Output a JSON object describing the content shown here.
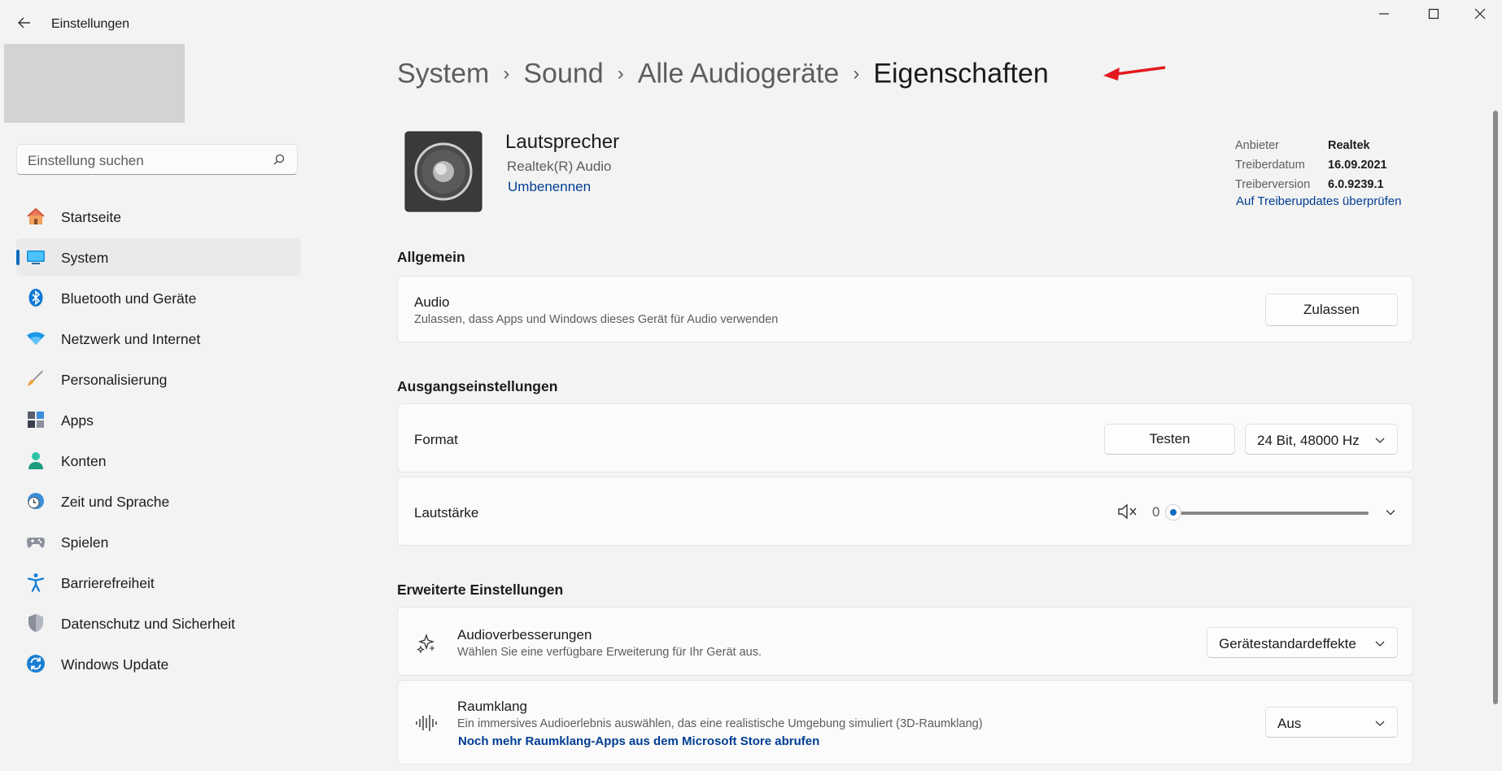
{
  "window": {
    "title": "Einstellungen",
    "back_icon": "back-arrow-icon",
    "controls": {
      "minimize": "—",
      "maximize": "☐",
      "close": "✕"
    }
  },
  "sidebar": {
    "search_placeholder": "Einstellung suchen",
    "items": [
      {
        "label": "Startseite",
        "icon": "home-icon"
      },
      {
        "label": "System",
        "icon": "monitor-icon",
        "selected": true
      },
      {
        "label": "Bluetooth und Geräte",
        "icon": "bluetooth-icon"
      },
      {
        "label": "Netzwerk und Internet",
        "icon": "wifi-icon"
      },
      {
        "label": "Personalisierung",
        "icon": "brush-icon"
      },
      {
        "label": "Apps",
        "icon": "apps-icon"
      },
      {
        "label": "Konten",
        "icon": "person-icon"
      },
      {
        "label": "Zeit und Sprache",
        "icon": "clock-globe-icon"
      },
      {
        "label": "Spielen",
        "icon": "gamepad-icon"
      },
      {
        "label": "Barrierefreiheit",
        "icon": "accessibility-icon"
      },
      {
        "label": "Datenschutz und Sicherheit",
        "icon": "shield-icon"
      },
      {
        "label": "Windows Update",
        "icon": "update-icon"
      }
    ]
  },
  "breadcrumb": {
    "items": [
      "System",
      "Sound",
      "Alle Audiogeräte"
    ],
    "current": "Eigenschaften",
    "separator": "›"
  },
  "device": {
    "name": "Lautsprecher",
    "driver_name": "Realtek(R) Audio",
    "rename_link": "Umbenennen",
    "meta_labels": [
      "Anbieter",
      "Treiberdatum",
      "Treiberversion"
    ],
    "meta_values": [
      "Realtek",
      "16.09.2021",
      "6.0.9239.1"
    ],
    "update_link": "Auf Treiberupdates überprüfen"
  },
  "general": {
    "section_title": "Allgemein",
    "audio_title": "Audio",
    "audio_desc": "Zulassen, dass Apps und Windows dieses Gerät für Audio verwenden",
    "allow_button": "Zulassen"
  },
  "output": {
    "section_title": "Ausgangseinstellungen",
    "format_label": "Format",
    "test_button": "Testen",
    "format_value": "24 Bit, 48000 Hz",
    "volume_label": "Lautstärke",
    "volume_value": "0",
    "volume_level": 0
  },
  "advanced": {
    "section_title": "Erweiterte Einstellungen",
    "enh_title": "Audioverbesserungen",
    "enh_desc": "Wählen Sie eine verfügbare Erweiterung für Ihr Gerät aus.",
    "enh_value": "Gerätestandardeffekte",
    "spatial_title": "Raumklang",
    "spatial_desc": "Ein immersives Audioerlebnis auswählen, das eine realistische Umgebung simuliert (3D-Raumklang)",
    "spatial_link": "Noch mehr Raumklang-Apps aus dem Microsoft Store abrufen",
    "spatial_value": "Aus"
  },
  "colors": {
    "accent": "#0f6cbd",
    "link": "#003e92",
    "annotation_arrow": "#e3191d"
  }
}
